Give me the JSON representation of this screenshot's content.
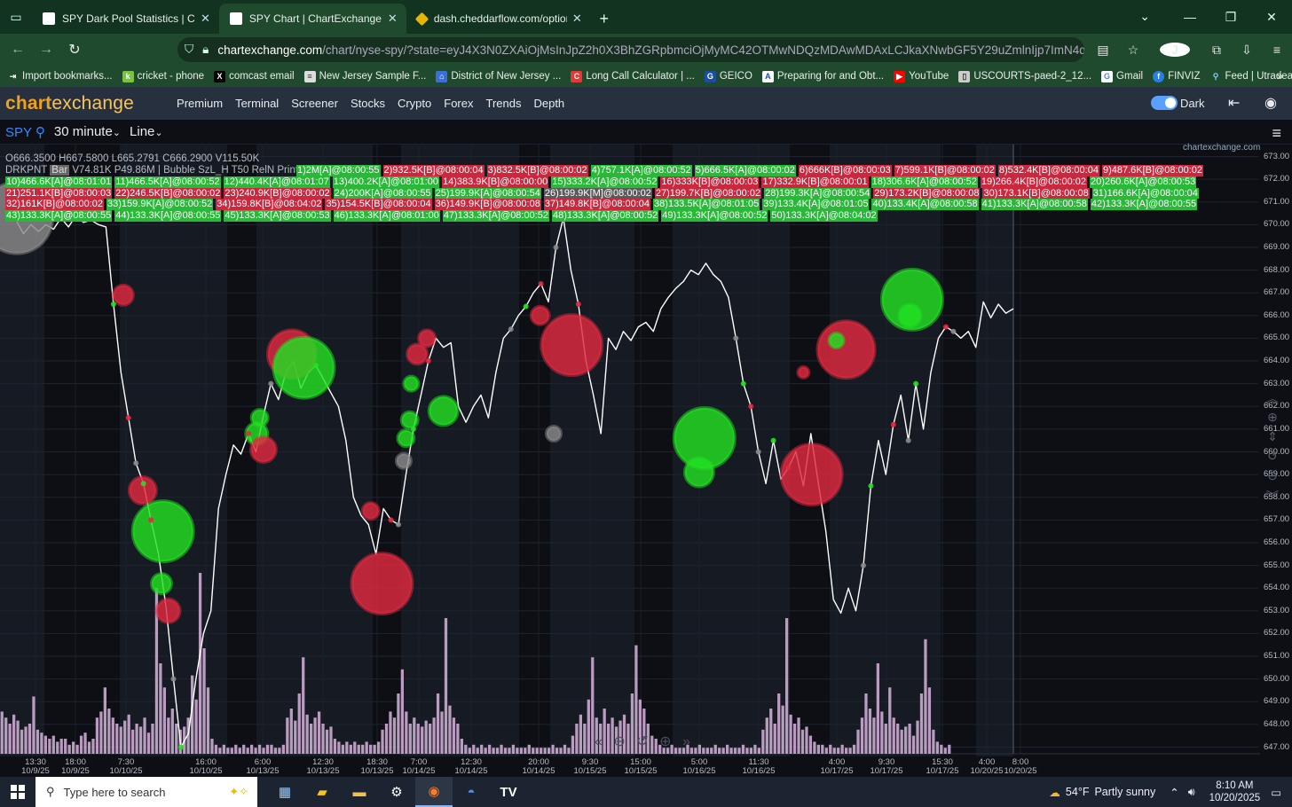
{
  "browser": {
    "tabs": [
      {
        "title": "SPY Dark Pool Statistics | ChartE",
        "active": false
      },
      {
        "title": "SPY Chart | ChartExchange",
        "active": true
      },
      {
        "title": "dash.cheddarflow.com/options-",
        "active": false
      }
    ],
    "url_host": "chartexchange.com",
    "url_rest": "/chart/nyse-spy/?state=eyJ4X3N0ZXAiOjMsInJpZ2h0X3BhZGRpbmciOjMyMC42OTMwNDQzMDAwMDAxLCJkaXNwbGF5Y29uZmlnIjp7ImN4dWlkIjoiMjlyN",
    "profile_initial": "J",
    "bookmarks": [
      "Import bookmarks...",
      "cricket - phone",
      "comcast email",
      "New Jersey Sample F...",
      "District of New Jersey ...",
      "Long Call Calculator | ...",
      "GEICO",
      "Preparing for and Obt...",
      "YouTube",
      "USCOURTS-paed-2_12...",
      "Gmail",
      "FINVIZ",
      "Feed | Utradea"
    ]
  },
  "site": {
    "logo_a": "chart",
    "logo_b": "exchange",
    "menu": [
      "Premium",
      "Terminal",
      "Screener",
      "Stocks",
      "Crypto",
      "Forex",
      "Trends",
      "Depth"
    ],
    "theme_label": "Dark"
  },
  "toolbar": {
    "symbol": "SPY",
    "interval": "30 minute",
    "chart_style": "Line"
  },
  "legend": {
    "ohlc": "O666.3500 H667.5800 L665.2791 C666.2900 V115.50K",
    "drkpnt_prefix": "DRKPNT",
    "drkpnt_bar": "Bar",
    "drkpnt_rest": "V74.81K P49.86M | Bubble SzL_H T50 RelN Prints",
    "watermark": "chartexchange.com"
  },
  "prints": [
    {
      "t": "1)2M[A]@08:00:55",
      "s": "A"
    },
    {
      "t": "2)932.5K[B]@08:00:04",
      "s": "B"
    },
    {
      "t": "3)832.5K[B]@08:00:02",
      "s": "B"
    },
    {
      "t": "4)757.1K[A]@08:00:52",
      "s": "A"
    },
    {
      "t": "5)666.5K[A]@08:00:02",
      "s": "A"
    },
    {
      "t": "6)666K[B]@08:00:03",
      "s": "B"
    },
    {
      "t": "7)599.1K[B]@08:00:02",
      "s": "B"
    },
    {
      "t": "8)532.4K[B]@08:00:04",
      "s": "B"
    },
    {
      "t": "9)487.6K[B]@08:00:02",
      "s": "B"
    },
    {
      "t": "10)466.6K[A]@08:01:01",
      "s": "A"
    },
    {
      "t": "11)466.5K[A]@08:00:52",
      "s": "A"
    },
    {
      "t": "12)440.4K[A]@08:01:07",
      "s": "A"
    },
    {
      "t": "13)400.2K[A]@08:01:00",
      "s": "A"
    },
    {
      "t": "14)383.9K[B]@08:00:00",
      "s": "B"
    },
    {
      "t": "15)333.2K[A]@08:00:52",
      "s": "A"
    },
    {
      "t": "16)333K[B]@08:00:03",
      "s": "B"
    },
    {
      "t": "17)332.9K[B]@08:00:01",
      "s": "B"
    },
    {
      "t": "18)306.6K[A]@08:00:52",
      "s": "A"
    },
    {
      "t": "19)266.4K[B]@08:00:02",
      "s": "B"
    },
    {
      "t": "20)260.6K[A]@08:00:53",
      "s": "A"
    },
    {
      "t": "21)251.1K[B]@08:00:03",
      "s": "B"
    },
    {
      "t": "22)246.5K[B]@08:00:02",
      "s": "B"
    },
    {
      "t": "23)240.9K[B]@08:00:02",
      "s": "B"
    },
    {
      "t": "24)200K[A]@08:00:55",
      "s": "A"
    },
    {
      "t": "25)199.9K[A]@08:00:54",
      "s": "A"
    },
    {
      "t": "26)199.9K[M]@08:00:02",
      "s": "M"
    },
    {
      "t": "27)199.7K[B]@08:00:02",
      "s": "B"
    },
    {
      "t": "28)199.3K[A]@08:00:54",
      "s": "A"
    },
    {
      "t": "29)173.2K[B]@08:00:08",
      "s": "B"
    },
    {
      "t": "30)173.1K[B]@08:00:08",
      "s": "B"
    },
    {
      "t": "31)166.6K[A]@08:00:04",
      "s": "A"
    },
    {
      "t": "32)161K[B]@08:00:02",
      "s": "B"
    },
    {
      "t": "33)159.9K[A]@08:00:52",
      "s": "A"
    },
    {
      "t": "34)159.8K[B]@08:04:02",
      "s": "B"
    },
    {
      "t": "35)154.5K[B]@08:00:04",
      "s": "B"
    },
    {
      "t": "36)149.9K[B]@08:00:08",
      "s": "B"
    },
    {
      "t": "37)149.8K[B]@08:00:04",
      "s": "B"
    },
    {
      "t": "38)133.5K[A]@08:01:05",
      "s": "A"
    },
    {
      "t": "39)133.4K[A]@08:01:05",
      "s": "A"
    },
    {
      "t": "40)133.4K[A]@08:00:58",
      "s": "A"
    },
    {
      "t": "41)133.3K[A]@08:00:58",
      "s": "A"
    },
    {
      "t": "42)133.3K[A]@08:00:55",
      "s": "A"
    },
    {
      "t": "43)133.3K[A]@08:00:55",
      "s": "A"
    },
    {
      "t": "44)133.3K[A]@08:00:55",
      "s": "A"
    },
    {
      "t": "45)133.3K[A]@08:00:53",
      "s": "A"
    },
    {
      "t": "46)133.3K[A]@08:01:00",
      "s": "A"
    },
    {
      "t": "47)133.3K[A]@08:00:52",
      "s": "A"
    },
    {
      "t": "48)133.3K[A]@08:00:52",
      "s": "A"
    },
    {
      "t": "49)133.3K[A]@08:00:52",
      "s": "A"
    },
    {
      "t": "50)133.3K[A]@08:04:02",
      "s": "A"
    }
  ],
  "chart_data": {
    "type": "line",
    "y_ticks": [
      "673.00",
      "672.00",
      "671.00",
      "670.00",
      "669.00",
      "668.00",
      "667.00",
      "666.00",
      "665.00",
      "664.00",
      "663.00",
      "662.00",
      "661.00",
      "660.00",
      "659.00",
      "658.00",
      "657.00",
      "656.00",
      "655.00",
      "654.00",
      "653.00",
      "652.00",
      "651.00",
      "650.00",
      "649.00",
      "648.00",
      "647.00"
    ],
    "ylim": [
      646.8,
      673.5
    ],
    "x_ticks": [
      {
        "time": "13:30",
        "date": "10/9/25"
      },
      {
        "time": "18:00",
        "date": "10/9/25"
      },
      {
        "time": "7:30",
        "date": "10/10/25"
      },
      {
        "time": "16:00",
        "date": "10/10/25"
      },
      {
        "time": "6:00",
        "date": "10/13/25"
      },
      {
        "time": "12:30",
        "date": "10/13/25"
      },
      {
        "time": "18:30",
        "date": "10/13/25"
      },
      {
        "time": "7:00",
        "date": "10/14/25"
      },
      {
        "time": "12:30",
        "date": "10/14/25"
      },
      {
        "time": "20:00",
        "date": "10/14/25"
      },
      {
        "time": "9:30",
        "date": "10/15/25"
      },
      {
        "time": "15:00",
        "date": "10/15/25"
      },
      {
        "time": "5:00",
        "date": "10/16/25"
      },
      {
        "time": "11:30",
        "date": "10/16/25"
      },
      {
        "time": "4:00",
        "date": "10/17/25"
      },
      {
        "time": "9:30",
        "date": "10/17/25"
      },
      {
        "time": "15:30",
        "date": "10/17/25"
      },
      {
        "time": "4:00",
        "date": "10/20/25"
      },
      {
        "time": "8:00",
        "date": "10/20/25"
      }
    ],
    "price": [
      670.2,
      669.6,
      670.0,
      669.7,
      670.0,
      669.8,
      670.3,
      669.9,
      670.4,
      670.1,
      670.2,
      670.0,
      669.9,
      666.5,
      663.5,
      661.5,
      659.5,
      658.6,
      657.0,
      655.5,
      653.2,
      650.0,
      647.0,
      647.6,
      650.0,
      652.0,
      653.0,
      657.5,
      659.0,
      660.3,
      659.9,
      660.8,
      660.0,
      661.6,
      663.0,
      662.3,
      663.5,
      664.0,
      662.8,
      663.5,
      663.8,
      663.2,
      662.6,
      662.0,
      660.5,
      658.0,
      657.2,
      656.8,
      655.5,
      657.5,
      657.0,
      656.8,
      659.0,
      661.0,
      662.5,
      664.0,
      665.0,
      664.6,
      664.8,
      662.0,
      661.3,
      662.0,
      662.5,
      661.5,
      663.5,
      665.0,
      665.4,
      666.0,
      666.4,
      667.0,
      667.4,
      666.6,
      669.0,
      670.3,
      668.0,
      666.5,
      664.0,
      662.5,
      660.8,
      665.0,
      664.5,
      665.3,
      664.9,
      665.5,
      665.7,
      665.3,
      666.3,
      666.8,
      667.2,
      667.5,
      668.0,
      667.8,
      668.3,
      667.8,
      667.5,
      666.8,
      665.0,
      663.0,
      662.0,
      660.0,
      658.6,
      660.5,
      658.8,
      659.3,
      660.0,
      658.5,
      660.8,
      658.6,
      656.5,
      653.5,
      652.9,
      654.0,
      653.0,
      655.0,
      658.5,
      660.5,
      659.0,
      661.2,
      662.5,
      660.5,
      663.0,
      661.0,
      663.5,
      665.0,
      665.5,
      665.3,
      665.0,
      665.3,
      664.6,
      666.6,
      665.9,
      666.5,
      666.1,
      666.3
    ],
    "volume": [
      0.14,
      0.12,
      0.1,
      0.13,
      0.11,
      0.08,
      0.09,
      0.1,
      0.19,
      0.08,
      0.07,
      0.06,
      0.05,
      0.06,
      0.04,
      0.05,
      0.05,
      0.03,
      0.04,
      0.03,
      0.06,
      0.07,
      0.04,
      0.05,
      0.12,
      0.14,
      0.22,
      0.15,
      0.12,
      0.1,
      0.09,
      0.11,
      0.13,
      0.08,
      0.1,
      0.09,
      0.12,
      0.07,
      0.1,
      0.55,
      0.3,
      0.22,
      0.12,
      0.15,
      0.1,
      0.08,
      0.09,
      0.12,
      0.26,
      0.18,
      0.6,
      0.35,
      0.22,
      0.05,
      0.03,
      0.02,
      0.03,
      0.02,
      0.02,
      0.03,
      0.02,
      0.03,
      0.02,
      0.03,
      0.02,
      0.03,
      0.02,
      0.03,
      0.03,
      0.02,
      0.02,
      0.03,
      0.12,
      0.15,
      0.11,
      0.2,
      0.32,
      0.13,
      0.1,
      0.12,
      0.14,
      0.1,
      0.08,
      0.09,
      0.05,
      0.04,
      0.03,
      0.04,
      0.03,
      0.04,
      0.03,
      0.03,
      0.04,
      0.03,
      0.03,
      0.04,
      0.08,
      0.1,
      0.14,
      0.12,
      0.2,
      0.28,
      0.14,
      0.1,
      0.12,
      0.1,
      0.09,
      0.11,
      0.1,
      0.12,
      0.2,
      0.14,
      0.45,
      0.16,
      0.12,
      0.1,
      0.05,
      0.03,
      0.02,
      0.03,
      0.02,
      0.03,
      0.02,
      0.03,
      0.02,
      0.02,
      0.03,
      0.02,
      0.02,
      0.03,
      0.02,
      0.02,
      0.02,
      0.03,
      0.02,
      0.02,
      0.02,
      0.02,
      0.02,
      0.03,
      0.02,
      0.02,
      0.03,
      0.02,
      0.06,
      0.1,
      0.13,
      0.1,
      0.18,
      0.32,
      0.12,
      0.1,
      0.15,
      0.1,
      0.12,
      0.09,
      0.11,
      0.13,
      0.1,
      0.2,
      0.36,
      0.18,
      0.15,
      0.1,
      0.06,
      0.05,
      0.03,
      0.02,
      0.02,
      0.03,
      0.02,
      0.02,
      0.02,
      0.03,
      0.02,
      0.02,
      0.03,
      0.02,
      0.02,
      0.02,
      0.03,
      0.02,
      0.02,
      0.03,
      0.02,
      0.02,
      0.02,
      0.03,
      0.02,
      0.02,
      0.03,
      0.02,
      0.08,
      0.12,
      0.15,
      0.1,
      0.2,
      0.16,
      0.45,
      0.13,
      0.1,
      0.12,
      0.08,
      0.09,
      0.06,
      0.04,
      0.03,
      0.03,
      0.02,
      0.03,
      0.02,
      0.02,
      0.03,
      0.02,
      0.02,
      0.03,
      0.08,
      0.12,
      0.2,
      0.15,
      0.12,
      0.3,
      0.14,
      0.1,
      0.22,
      0.12,
      0.1,
      0.08,
      0.09,
      0.1,
      0.06,
      0.11,
      0.2,
      0.38,
      0.22,
      0.08,
      0.04,
      0.03,
      0.02,
      0.03
    ],
    "bubbles": [
      {
        "i": 0.12,
        "p": 670.3,
        "r": 40,
        "side": "M"
      },
      {
        "i": 0.17,
        "p": 670.5,
        "r": 5,
        "side": "M"
      },
      {
        "i": 14.3,
        "p": 666.9,
        "r": 11,
        "side": "B"
      },
      {
        "i": 16.9,
        "p": 658.3,
        "r": 15,
        "side": "B"
      },
      {
        "i": 19.6,
        "p": 656.5,
        "r": 34,
        "side": "A"
      },
      {
        "i": 19.4,
        "p": 654.2,
        "r": 11,
        "side": "A"
      },
      {
        "i": 20.3,
        "p": 653.0,
        "r": 13,
        "side": "B"
      },
      {
        "i": 32.5,
        "p": 661.5,
        "r": 9,
        "side": "A"
      },
      {
        "i": 32.1,
        "p": 660.8,
        "r": 12,
        "side": "A"
      },
      {
        "i": 33.0,
        "p": 660.1,
        "r": 14,
        "side": "B"
      },
      {
        "i": 36.8,
        "p": 664.3,
        "r": 27,
        "side": "B"
      },
      {
        "i": 38.4,
        "p": 663.7,
        "r": 34,
        "side": "A"
      },
      {
        "i": 47.3,
        "p": 657.4,
        "r": 9,
        "side": "B"
      },
      {
        "i": 48.8,
        "p": 654.2,
        "r": 34,
        "side": "B"
      },
      {
        "i": 52.7,
        "p": 663.0,
        "r": 8,
        "side": "A"
      },
      {
        "i": 52.5,
        "p": 661.4,
        "r": 9,
        "side": "A"
      },
      {
        "i": 52.0,
        "p": 660.6,
        "r": 9,
        "side": "A"
      },
      {
        "i": 51.7,
        "p": 659.6,
        "r": 8,
        "side": "M"
      },
      {
        "i": 53.5,
        "p": 664.3,
        "r": 11,
        "side": "B"
      },
      {
        "i": 54.8,
        "p": 665.0,
        "r": 9,
        "side": "B"
      },
      {
        "i": 57.0,
        "p": 661.8,
        "r": 16,
        "side": "A"
      },
      {
        "i": 69.9,
        "p": 666.0,
        "r": 10,
        "side": "B"
      },
      {
        "i": 74.1,
        "p": 664.7,
        "r": 34,
        "side": "B"
      },
      {
        "i": 71.7,
        "p": 660.8,
        "r": 8,
        "side": "M"
      },
      {
        "i": 91.8,
        "p": 660.6,
        "r": 34,
        "side": "A"
      },
      {
        "i": 91.1,
        "p": 659.1,
        "r": 16,
        "side": "A"
      },
      {
        "i": 106.1,
        "p": 659.0,
        "r": 34,
        "side": "B"
      },
      {
        "i": 105.0,
        "p": 663.5,
        "r": 6,
        "side": "B"
      },
      {
        "i": 110.7,
        "p": 664.5,
        "r": 32,
        "side": "B"
      },
      {
        "i": 109.4,
        "p": 664.9,
        "r": 8,
        "side": "A"
      },
      {
        "i": 119.5,
        "p": 666.7,
        "r": 34,
        "side": "A"
      },
      {
        "i": 119.2,
        "p": 666.0,
        "r": 12,
        "side": "A"
      }
    ]
  },
  "taskbar": {
    "search_placeholder": "Type here to search",
    "weather_temp": "54°F",
    "weather_desc": "Partly sunny",
    "time": "8:10 AM",
    "date": "10/20/2025"
  }
}
